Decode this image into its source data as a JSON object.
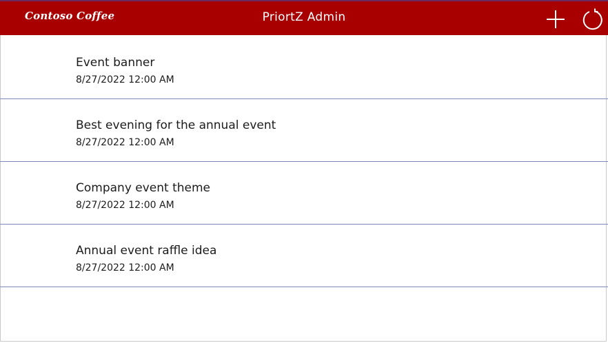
{
  "header": {
    "logo_text": "Contoso Coffee",
    "title": "PriortZ Admin",
    "add_icon": "plus-icon",
    "refresh_icon": "refresh-icon",
    "background_color": "#a80000"
  },
  "items": [
    {
      "title": "Event banner",
      "date": "8/27/2022 12:00 AM"
    },
    {
      "title": "Best evening for the annual event",
      "date": "8/27/2022 12:00 AM"
    },
    {
      "title": "Company event theme",
      "date": "8/27/2022 12:00 AM"
    },
    {
      "title": "Annual event raffle idea",
      "date": "8/27/2022 12:00 AM"
    }
  ]
}
